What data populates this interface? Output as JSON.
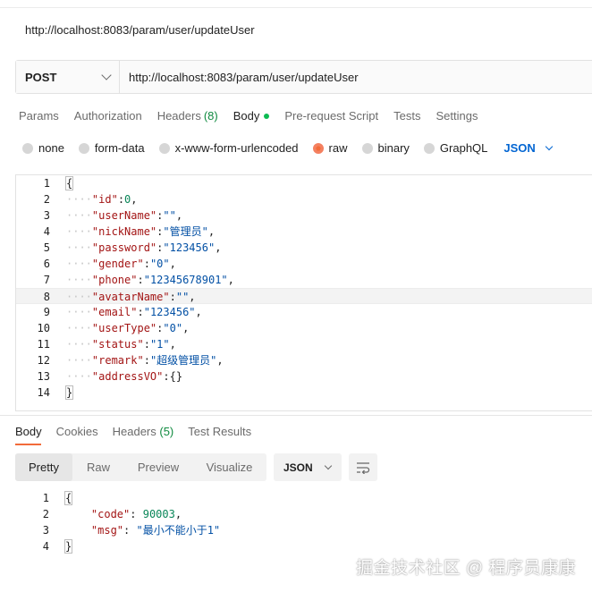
{
  "title_url": "http://localhost:8083/param/user/updateUser",
  "request": {
    "method": "POST",
    "url": "http://localhost:8083/param/user/updateUser",
    "tabs": [
      {
        "label": "Params",
        "count": ""
      },
      {
        "label": "Authorization",
        "count": ""
      },
      {
        "label": "Headers",
        "count": "(8)"
      },
      {
        "label": "Body",
        "count": ""
      },
      {
        "label": "Pre-request Script",
        "count": ""
      },
      {
        "label": "Tests",
        "count": ""
      },
      {
        "label": "Settings",
        "count": ""
      }
    ],
    "active_tab": "Body",
    "body_types": [
      "none",
      "form-data",
      "x-www-form-urlencoded",
      "raw",
      "binary",
      "GraphQL"
    ],
    "selected_body_type": "raw",
    "format": "JSON",
    "code_lines": [
      {
        "n": "1",
        "text": "{"
      },
      {
        "n": "2",
        "key": "\"id\"",
        "value": "0",
        "value_type": "number",
        "comma": true
      },
      {
        "n": "3",
        "key": "\"userName\"",
        "value": "\"\"",
        "value_type": "string",
        "comma": true
      },
      {
        "n": "4",
        "key": "\"nickName\"",
        "value": "\"管理员\"",
        "value_type": "string",
        "comma": true
      },
      {
        "n": "5",
        "key": "\"password\"",
        "value": "\"123456\"",
        "value_type": "string",
        "comma": true
      },
      {
        "n": "6",
        "key": "\"gender\"",
        "value": "\"0\"",
        "value_type": "string",
        "comma": true
      },
      {
        "n": "7",
        "key": "\"phone\"",
        "value": "\"12345678901\"",
        "value_type": "string",
        "comma": true
      },
      {
        "n": "8",
        "key": "\"avatarName\"",
        "value": "\"\"",
        "value_type": "string",
        "comma": true
      },
      {
        "n": "9",
        "key": "\"email\"",
        "value": "\"123456\"",
        "value_type": "string",
        "comma": true
      },
      {
        "n": "10",
        "key": "\"userType\"",
        "value": "\"0\"",
        "value_type": "string",
        "comma": true
      },
      {
        "n": "11",
        "key": "\"status\"",
        "value": "\"1\"",
        "value_type": "string",
        "comma": true
      },
      {
        "n": "12",
        "key": "\"remark\"",
        "value": "\"超级管理员\"",
        "value_type": "string",
        "comma": true
      },
      {
        "n": "13",
        "key": "\"addressVO\"",
        "value": "{}",
        "value_type": "plain",
        "comma": false
      },
      {
        "n": "14",
        "text": "}"
      }
    ],
    "highlighted_line": "8"
  },
  "response": {
    "tabs": [
      {
        "label": "Body",
        "count": ""
      },
      {
        "label": "Cookies",
        "count": ""
      },
      {
        "label": "Headers",
        "count": "(5)"
      },
      {
        "label": "Test Results",
        "count": ""
      }
    ],
    "active_tab": "Body",
    "views": [
      "Pretty",
      "Raw",
      "Preview",
      "Visualize"
    ],
    "active_view": "Pretty",
    "format": "JSON",
    "code_lines": [
      {
        "n": "1",
        "text": "{"
      },
      {
        "n": "2",
        "key": "\"code\"",
        "value": "90003",
        "value_type": "number",
        "comma": true
      },
      {
        "n": "3",
        "key": "\"msg\"",
        "value": "\"最小不能小于1\"",
        "value_type": "string",
        "comma": false
      },
      {
        "n": "4",
        "text": "}"
      }
    ]
  },
  "watermark": "掘金技术社区 @ 程序员康康",
  "colors": {
    "accent": "#f26b3a",
    "json_blue": "#0265d2",
    "count_green": "#0f8a3f",
    "body_dot": "#0cbb52",
    "key_red": "#a31515",
    "string_blue": "#0451a5",
    "number_green": "#098658"
  },
  "icons": {
    "method_dropdown": "chevron-down-icon",
    "format_dropdown": "chevron-down-icon",
    "wrap_lines": "wrap-lines-icon"
  }
}
